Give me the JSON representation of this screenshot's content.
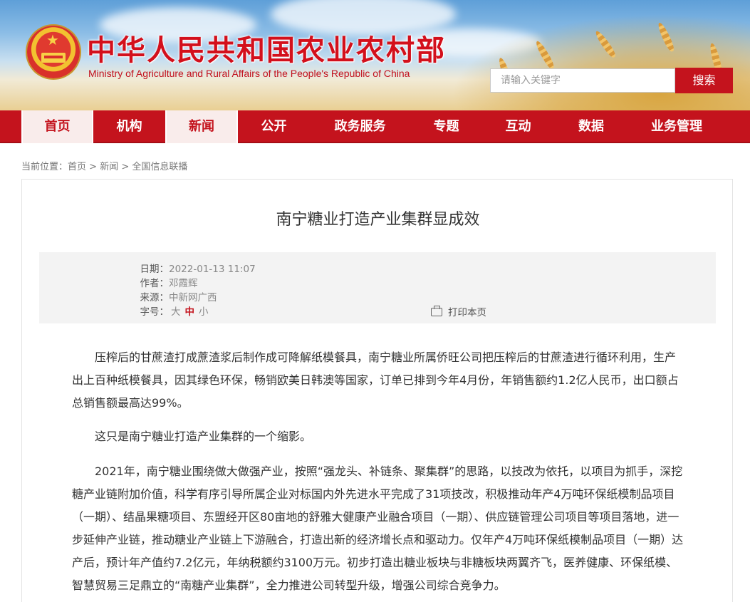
{
  "header": {
    "title": "中华人民共和国农业农村部",
    "subtitle": "Ministry of Agriculture and Rural Affairs of the People's Republic of China",
    "search_placeholder": "请输入关键字",
    "search_button": "搜索"
  },
  "nav": {
    "items": [
      {
        "label": "首页"
      },
      {
        "label": "机构"
      },
      {
        "label": "新闻"
      },
      {
        "label": "公开"
      },
      {
        "label": "政务服务"
      },
      {
        "label": "专题"
      },
      {
        "label": "互动"
      },
      {
        "label": "数据"
      },
      {
        "label": "业务管理"
      }
    ]
  },
  "breadcrumb": {
    "prefix": "当前位置：",
    "items": [
      "首页",
      "新闻",
      "全国信息联播"
    ],
    "sep": " > "
  },
  "article": {
    "title": "南宁糖业打造产业集群显成效",
    "meta": {
      "date_label": "日期：",
      "date": "2022-01-13 11:07",
      "author_label": "作者：",
      "author": "邓霞辉",
      "source_label": "来源：",
      "source": "中新网广西",
      "size_label": "字号：",
      "sizes": [
        "大",
        "中",
        "小"
      ],
      "print": "打印本页"
    },
    "paragraphs": [
      "压榨后的甘蔗渣打成蔗渣浆后制作成可降解纸模餐具，南宁糖业所属侨旺公司把压榨后的甘蔗渣进行循环利用，生产出上百种纸模餐具，因其绿色环保，畅销欧美日韩澳等国家，订单已排到今年4月份，年销售额约1.2亿人民币，出口额占总销售额最高达99%。",
      "这只是南宁糖业打造产业集群的一个缩影。",
      "2021年，南宁糖业围绕做大做强产业，按照“强龙头、补链条、聚集群”的思路，以技改为依托，以项目为抓手，深挖糖产业链附加价值，科学有序引导所属企业对标国内外先进水平完成了31项技改，积极推动年产4万吨环保纸模制品项目（一期）、结晶果糖项目、东盟经开区80亩地的舒雅大健康产业融合项目（一期）、供应链管理公司项目等项目落地，进一步延伸产业链，推动糖业产业链上下游融合，打造出新的经济增长点和驱动力。仅年产4万吨环保纸模制品项目（一期）达产后，预计年产值约7.2亿元，年纳税额约3100万元。初步打造出糖业板块与非糖板块两翼齐飞，医养健康、环保纸模、智慧贸易三足鼎立的“南糖产业集群”，全力推进公司转型升级，增强公司综合竞争力。"
    ]
  }
}
